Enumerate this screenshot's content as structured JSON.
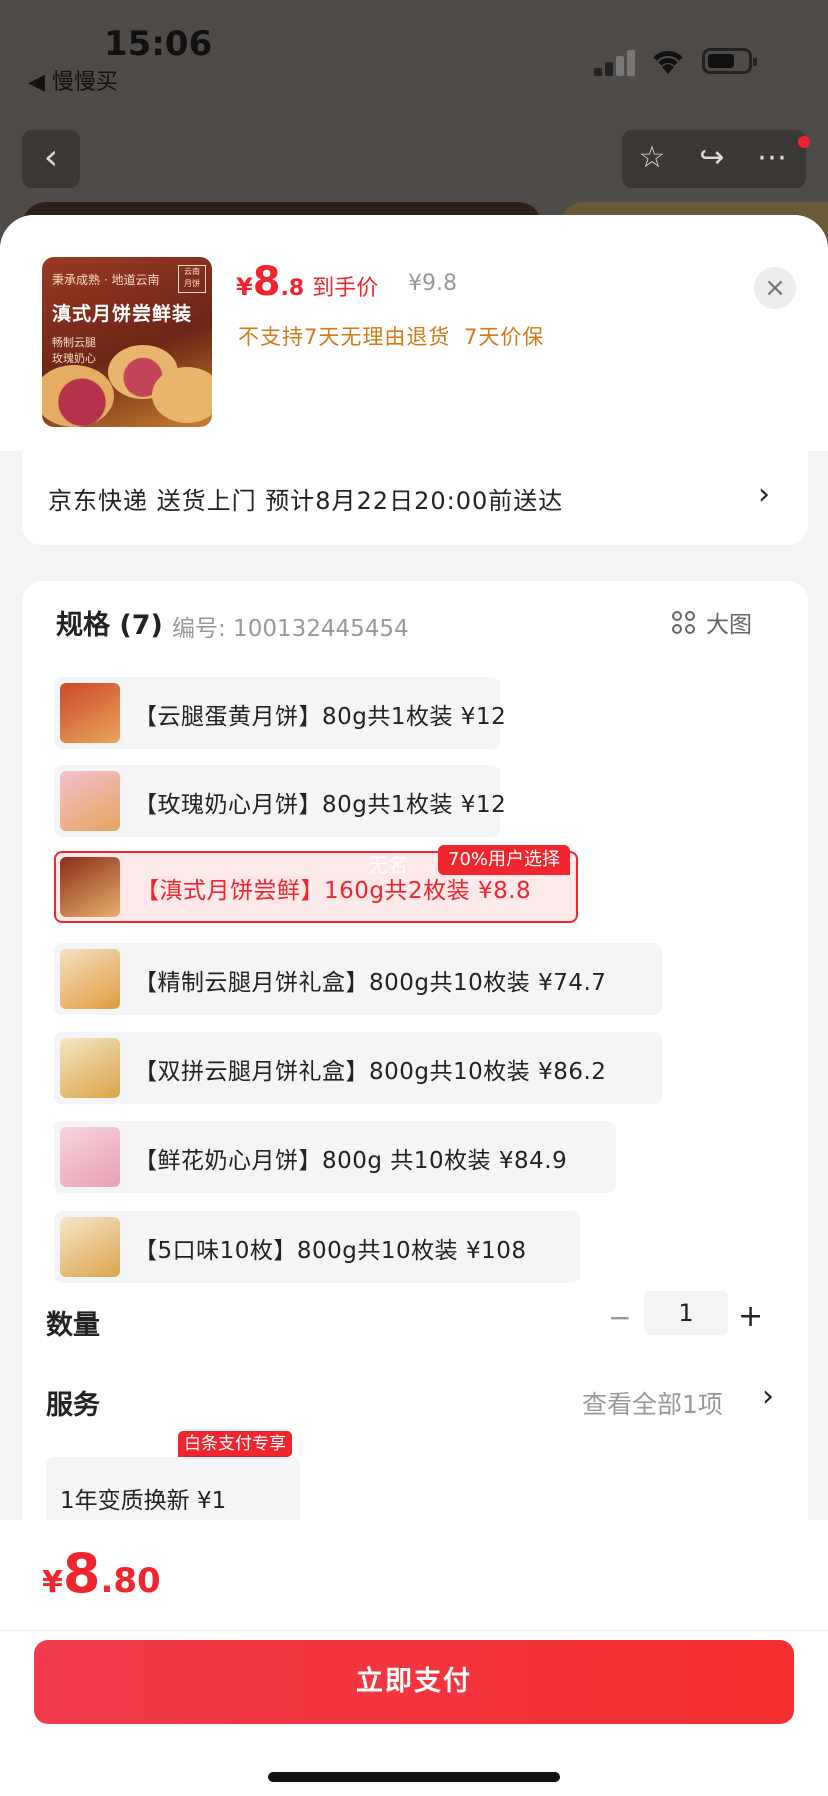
{
  "status_bar": {
    "time": "15:06",
    "back_app": "◀ 慢慢买"
  },
  "product": {
    "thumb_line1": "秉承成熟 · 地道云南",
    "thumb_title": "滇式月饼尝鲜装",
    "thumb_sub": "畅制云腿\n玫瑰奶心",
    "price_yen": "¥",
    "price_int": "8",
    "price_dec": ".8",
    "price_label": "到手价",
    "original_price": "¥9.8",
    "policy": "不支持7天无理由退货  7天价保"
  },
  "shipping": {
    "text": "京东快递 送货上门 预计8月22日20:00前送达"
  },
  "spec": {
    "title": "规格 (7)",
    "code": "编号: 100132445454",
    "big_image_label": "大图",
    "options": [
      {
        "label": "【云腿蛋黄月饼】80g共1枚装  ¥12",
        "selected": false
      },
      {
        "label": "【玫瑰奶心月饼】80g共1枚装  ¥12",
        "selected": false
      },
      {
        "label": "【滇式月饼尝鲜】160g共2枚装  ¥8.8",
        "selected": true
      },
      {
        "label": "【精制云腿月饼礼盒】800g共10枚装  ¥74.7",
        "selected": false
      },
      {
        "label": "【双拼云腿月饼礼盒】800g共10枚装  ¥86.2",
        "selected": false
      },
      {
        "label": "【鲜花奶心月饼】800g 共10枚装  ¥84.9",
        "selected": false
      },
      {
        "label": "【5口味10枚】800g共10枚装  ¥108",
        "selected": false
      }
    ],
    "popular_badge": "70%用户选择",
    "watermark": "无名"
  },
  "quantity": {
    "label": "数量",
    "minus": "−",
    "value": "1",
    "plus": "+"
  },
  "service": {
    "label": "服务",
    "view_all": "查看全部1项",
    "item_label": "1年变质换新  ¥1",
    "item_badge": "白条支付专享"
  },
  "footer": {
    "total_yen": "¥",
    "total_int": "8",
    "total_dec": ".80",
    "pay_button": "立即支付"
  },
  "colors": {
    "accent": "#f0252e",
    "policy": "#d27a16"
  }
}
